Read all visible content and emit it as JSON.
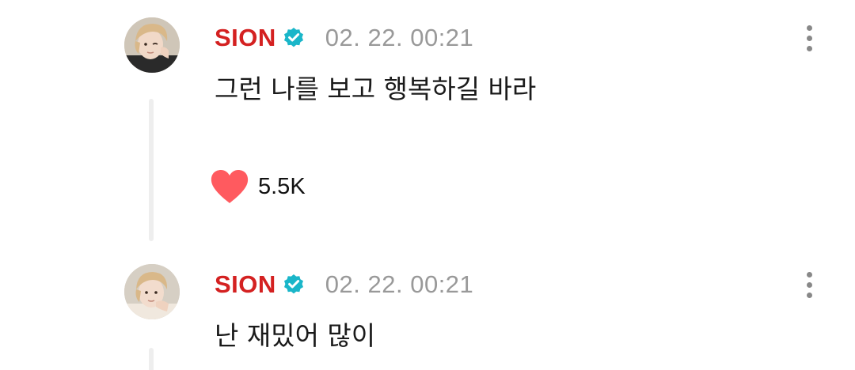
{
  "posts": [
    {
      "author": "SION",
      "verified_icon": "verified-badge-icon",
      "timestamp": "02. 22. 00:21",
      "message": "그런 나를 보고 행복하길 바라",
      "likes": "5.5K",
      "like_icon": "heart-icon",
      "menu_icon": "more-vertical-icon"
    },
    {
      "author": "SION",
      "verified_icon": "verified-badge-icon",
      "timestamp": "02. 22. 00:21",
      "message": "난 재밌어 많이",
      "menu_icon": "more-vertical-icon"
    }
  ],
  "colors": {
    "author": "#d42121",
    "verified": "#1ab6c9",
    "timestamp": "#999999",
    "heart": "#ff5a5f",
    "thread_line": "#eeeeee"
  }
}
